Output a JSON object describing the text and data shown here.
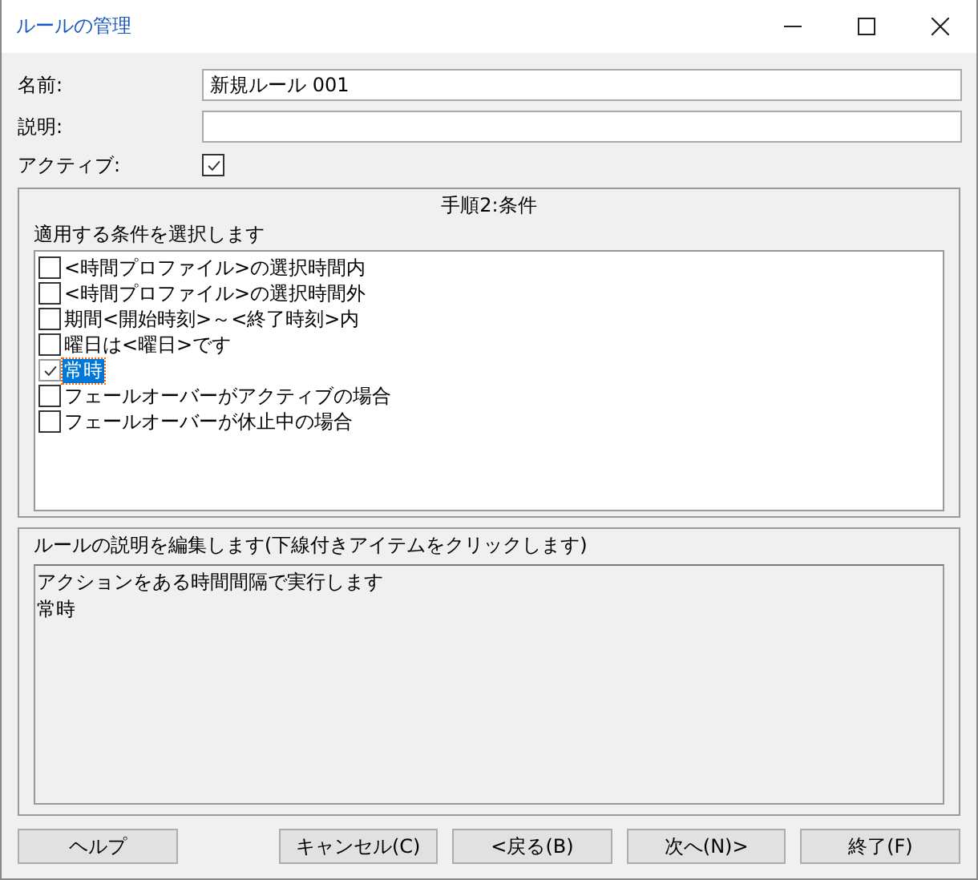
{
  "window": {
    "title": "ルールの管理"
  },
  "form": {
    "name_label": "名前:",
    "name_value": "新規ルール 001",
    "description_label": "説明:",
    "active_label": "アクティブ:",
    "active_checked": true
  },
  "conditions": {
    "title": "手順2:条件",
    "prompt": "適用する条件を選択します",
    "items": [
      {
        "label": "<時間プロファイル>の選択時間内",
        "checked": false,
        "selected": false
      },
      {
        "label": "<時間プロファイル>の選択時間外",
        "checked": false,
        "selected": false
      },
      {
        "label": "期間<開始時刻>～<終了時刻>内",
        "checked": false,
        "selected": false
      },
      {
        "label": "曜日は<曜日>です",
        "checked": false,
        "selected": false
      },
      {
        "label": "常時",
        "checked": true,
        "selected": true
      },
      {
        "label": "フェールオーバーがアクティブの場合",
        "checked": false,
        "selected": false
      },
      {
        "label": "フェールオーバーが休止中の場合",
        "checked": false,
        "selected": false
      }
    ]
  },
  "rule_description": {
    "title": "ルールの説明を編集します(下線付きアイテムをクリックします)",
    "lines": [
      "アクションをある時間間隔で実行します",
      "常時"
    ]
  },
  "buttons": [
    "ヘルプ",
    "キャンセル(C)",
    "<戻る(B)",
    "次へ(N)>",
    "終了(F)"
  ]
}
